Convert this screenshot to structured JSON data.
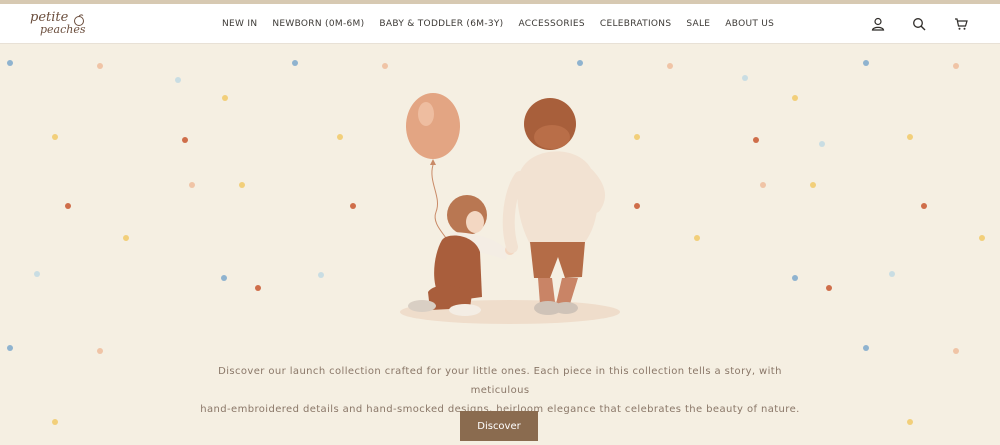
{
  "brand": {
    "line1": "petite",
    "line2": "peaches"
  },
  "nav": [
    {
      "label": "NEW IN"
    },
    {
      "label": "NEWBORN (0M-6M)"
    },
    {
      "label": "BABY & TODDLER (6M-3Y)"
    },
    {
      "label": "ACCESSORIES"
    },
    {
      "label": "CELEBRATIONS"
    },
    {
      "label": "SALE"
    },
    {
      "label": "ABOUT US"
    }
  ],
  "header_icons": [
    "account-icon",
    "search-icon",
    "cart-icon"
  ],
  "hero": {
    "image": "illustration of two toddlers holding hands with a peach balloon",
    "line1": "Discover our launch collection crafted for your little ones. Each piece in this collection tells a story, with meticulous",
    "line2": "hand-embroidered details and hand-smocked designs, heirloom elegance that celebrates the beauty of nature.",
    "cta": "Discover"
  },
  "colors": {
    "background": "#f5efe2",
    "button": "#8a6b4f",
    "dot_blue": "#8fb3cf",
    "dot_peach": "#f0c4a6",
    "dot_yellow": "#f2cf7a",
    "dot_rust": "#cf6e4a",
    "dot_lightblue": "#c9dde3"
  }
}
